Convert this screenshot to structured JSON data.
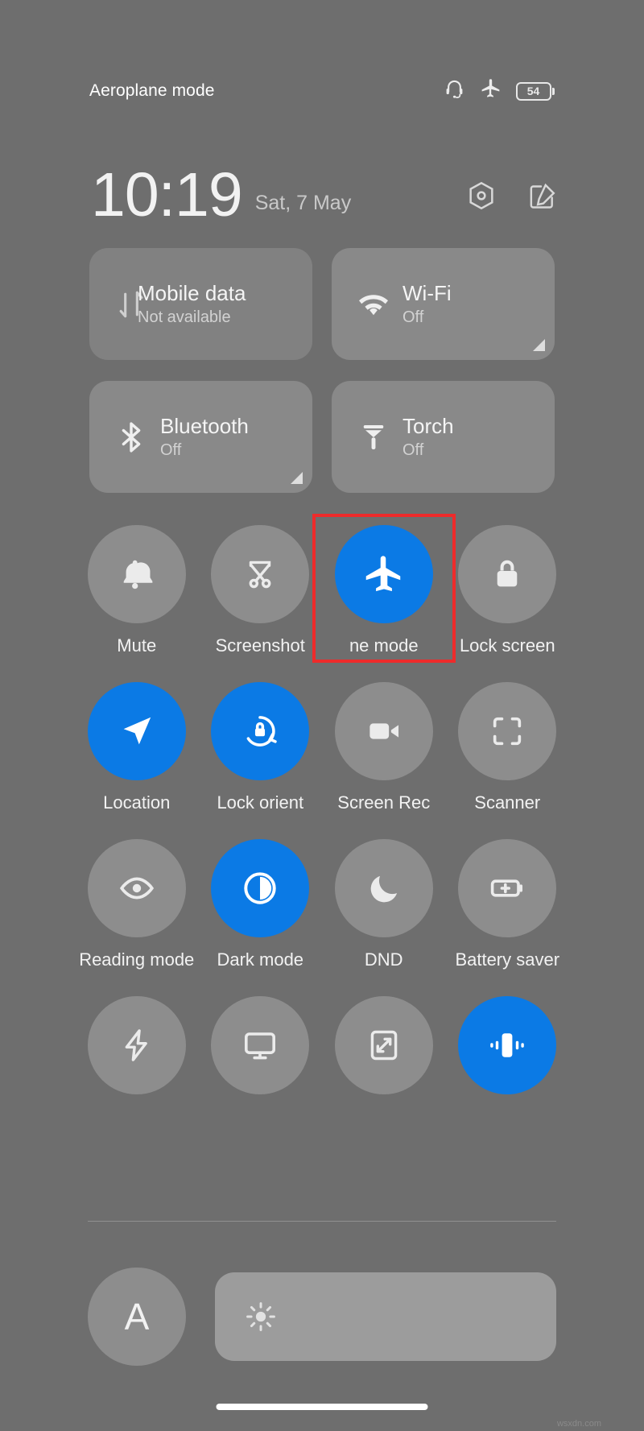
{
  "statusbar": {
    "title": "Aeroplane mode",
    "icons": [
      "headset-icon",
      "airplane-icon"
    ],
    "battery_level": "54"
  },
  "header": {
    "time": "10:19",
    "date": "Sat, 7 May",
    "settings_icon": "hexagon-settings-icon",
    "edit_icon": "edit-pencil-icon"
  },
  "big_tiles": [
    {
      "title": "Mobile data",
      "subtitle": "Not available",
      "icon": "mobile-data-icon",
      "active": false,
      "expandable": false,
      "clipped": true
    },
    {
      "title": "Wi-Fi",
      "subtitle": "Off",
      "icon": "wifi-icon",
      "active": false,
      "expandable": true,
      "clipped": false
    },
    {
      "title": "Bluetooth",
      "subtitle": "Off",
      "icon": "bluetooth-icon",
      "active": false,
      "expandable": true,
      "clipped": false
    },
    {
      "title": "Torch",
      "subtitle": "Off",
      "icon": "torch-icon",
      "active": false,
      "expandable": false,
      "clipped": false
    }
  ],
  "toggles": [
    {
      "label": "Mute",
      "icon": "bell-mute-icon",
      "active": false,
      "highlighted": false
    },
    {
      "label": "Screenshot",
      "icon": "screenshot-icon",
      "active": false,
      "highlighted": false
    },
    {
      "label": "ne mode",
      "icon": "airplane-icon",
      "active": true,
      "highlighted": true
    },
    {
      "label": "Lock screen",
      "icon": "lock-icon",
      "active": false,
      "highlighted": false
    },
    {
      "label": "Location",
      "icon": "location-arrow-icon",
      "active": true,
      "highlighted": false
    },
    {
      "label": "Lock orient",
      "icon": "rotation-lock-icon",
      "active": true,
      "highlighted": false
    },
    {
      "label": "Screen Rec",
      "icon": "video-camera-icon",
      "active": false,
      "highlighted": false
    },
    {
      "label": "Scanner",
      "icon": "scan-frame-icon",
      "active": false,
      "highlighted": false
    },
    {
      "label": "Reading mode",
      "icon": "eye-icon",
      "active": false,
      "highlighted": false
    },
    {
      "label": "Dark mode",
      "icon": "contrast-circle-icon",
      "active": true,
      "highlighted": false
    },
    {
      "label": "DND",
      "icon": "moon-icon",
      "active": false,
      "highlighted": false
    },
    {
      "label": "Battery saver",
      "icon": "battery-plus-icon",
      "active": false,
      "highlighted": false
    },
    {
      "label": "",
      "icon": "lightning-bolt-icon",
      "active": false,
      "highlighted": false
    },
    {
      "label": "",
      "icon": "cast-monitor-icon",
      "active": false,
      "highlighted": false
    },
    {
      "label": "",
      "icon": "resize-expand-icon",
      "active": false,
      "highlighted": false
    },
    {
      "label": "",
      "icon": "vibrate-icon",
      "active": true,
      "highlighted": false
    }
  ],
  "brightness": {
    "auto_label": "A",
    "slider_icon": "sun-icon",
    "fill_percent": 0
  },
  "watermark": "wsxdn.com",
  "colors": {
    "background": "#6e6e6e",
    "accent_active": "#0b7ae5",
    "highlight_box": "#ee2b2b",
    "text_primary": "#f2f2f2",
    "text_secondary": "#c9c9c9"
  }
}
